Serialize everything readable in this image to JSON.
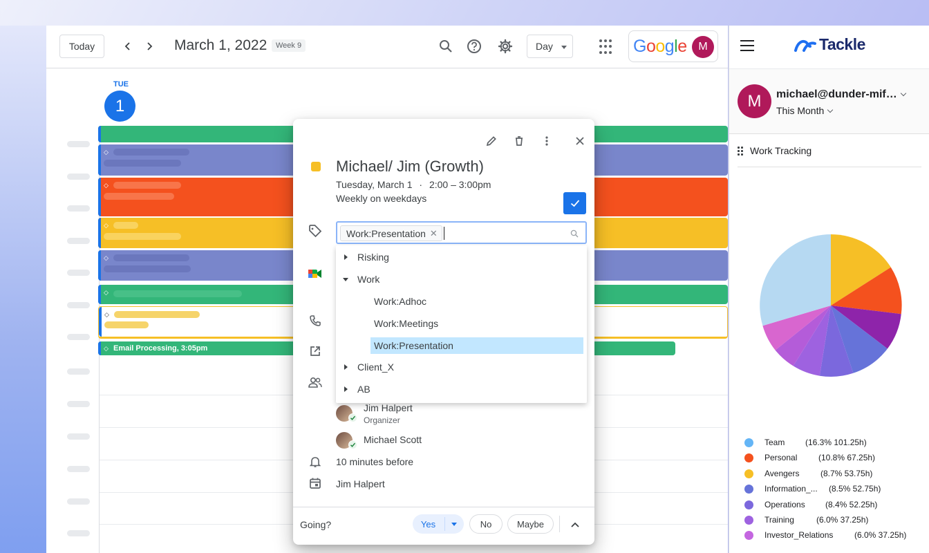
{
  "calendar": {
    "today_label": "Today",
    "date_title": "March 1, 2022",
    "week_badge": "Week 9",
    "view": "Day",
    "day_of_week": "TUE",
    "day_number": "1",
    "google_label": "Google",
    "avatar_letter": "M",
    "email_event_label": "Email Processing, 3:05pm"
  },
  "event_popup": {
    "title": "Michael/ Jim (Growth)",
    "date": "Tuesday, March 1",
    "time": "2:00 – 3:00pm",
    "recurrence": "Weekly on weekdays",
    "tag_chip": "Work:Presentation",
    "tag_options": [
      {
        "label": "Risking",
        "level": 0,
        "expander": "collapsed"
      },
      {
        "label": "Work",
        "level": 0,
        "expander": "expanded"
      },
      {
        "label": "Work:Adhoc",
        "level": 1,
        "expander": "none"
      },
      {
        "label": "Work:Meetings",
        "level": 1,
        "expander": "none"
      },
      {
        "label": "Work:Presentation",
        "level": 1,
        "expander": "none",
        "selected": true
      },
      {
        "label": "Client_X",
        "level": 0,
        "expander": "collapsed"
      },
      {
        "label": "AB",
        "level": 0,
        "expander": "collapsed"
      }
    ],
    "guests": [
      {
        "name": "Jim Halpert",
        "role": "Organizer"
      },
      {
        "name": "Michael Scott",
        "role": ""
      }
    ],
    "reminder": "10 minutes before",
    "calendar_owner": "Jim Halpert",
    "going_label": "Going?",
    "rsvp": {
      "yes": "Yes",
      "no": "No",
      "maybe": "Maybe"
    }
  },
  "tackle": {
    "brand": "Tackle",
    "avatar_letter": "M",
    "email": "michael@dunder-mif…",
    "period": "This Month",
    "section_title": "Work Tracking",
    "legend": [
      {
        "name": "Team",
        "value": "(16.3% 101.25h)",
        "color": "#64b5f6"
      },
      {
        "name": "Personal",
        "value": "(10.8% 67.25h)",
        "color": "#f4511e"
      },
      {
        "name": "Avengers",
        "value": "(8.7% 53.75h)",
        "color": "#f6bf26"
      },
      {
        "name": "Information_...",
        "value": "(8.5% 52.75h)",
        "color": "#6673d9"
      },
      {
        "name": "Operations",
        "value": "(8.4% 52.25h)",
        "color": "#7b68dd"
      },
      {
        "name": "Training",
        "value": "(6.0% 37.25h)",
        "color": "#9e62e0"
      },
      {
        "name": "Investor_Relations",
        "value": "(6.0% 37.25h)",
        "color": "#c466e0"
      }
    ]
  },
  "colors": {
    "accent": "#1a73e8",
    "event_green": "#33b679",
    "event_lavender": "#7986cb",
    "event_tangerine": "#f4511e",
    "event_banana": "#f6bf26",
    "tackle_brand": "#1b2a6b"
  }
}
